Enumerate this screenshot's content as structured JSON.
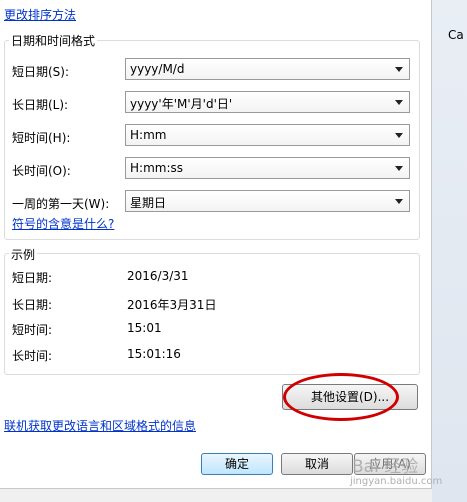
{
  "top_link": "更改排序方法",
  "datetime_group": {
    "title": "日期和时间格式",
    "rows": [
      {
        "label": "短日期(S):",
        "value": "yyyy/M/d"
      },
      {
        "label": "长日期(L):",
        "value": "yyyy'年'M'月'd'日'"
      },
      {
        "label": "短时间(H):",
        "value": "H:mm"
      },
      {
        "label": "长时间(O):",
        "value": "H:mm:ss"
      },
      {
        "label": "一周的第一天(W):",
        "value": "星期日"
      }
    ],
    "help_link": "符号的含意是什么?"
  },
  "example_group": {
    "title": "示例",
    "rows": [
      {
        "label": "短日期:",
        "value": "2016/3/31"
      },
      {
        "label": "长日期:",
        "value": "2016年3月31日"
      },
      {
        "label": "短时间:",
        "value": "15:01"
      },
      {
        "label": "长时间:",
        "value": "15:01:16"
      }
    ]
  },
  "other_settings_button": "其他设置(D)...",
  "online_link": "联机获取更改语言和区域格式的信息",
  "buttons": {
    "ok": "确定",
    "cancel": "取消",
    "apply": "应用(A)"
  },
  "right_strip_text": "Ca",
  "watermark": {
    "main": "Bai 经验",
    "sub": "jingyan.baidu.com"
  },
  "colors": {
    "link": "#0033cc",
    "highlight": "#d10000"
  }
}
